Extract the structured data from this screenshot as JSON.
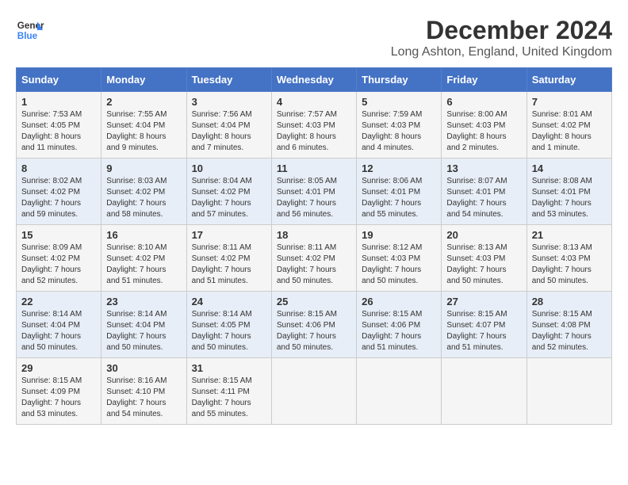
{
  "logo": {
    "line1": "General",
    "line2": "Blue"
  },
  "title": "December 2024",
  "subtitle": "Long Ashton, England, United Kingdom",
  "weekdays": [
    "Sunday",
    "Monday",
    "Tuesday",
    "Wednesday",
    "Thursday",
    "Friday",
    "Saturday"
  ],
  "weeks": [
    [
      {
        "day": "1",
        "info": "Sunrise: 7:53 AM\nSunset: 4:05 PM\nDaylight: 8 hours and 11 minutes."
      },
      {
        "day": "2",
        "info": "Sunrise: 7:55 AM\nSunset: 4:04 PM\nDaylight: 8 hours and 9 minutes."
      },
      {
        "day": "3",
        "info": "Sunrise: 7:56 AM\nSunset: 4:04 PM\nDaylight: 8 hours and 7 minutes."
      },
      {
        "day": "4",
        "info": "Sunrise: 7:57 AM\nSunset: 4:03 PM\nDaylight: 8 hours and 6 minutes."
      },
      {
        "day": "5",
        "info": "Sunrise: 7:59 AM\nSunset: 4:03 PM\nDaylight: 8 hours and 4 minutes."
      },
      {
        "day": "6",
        "info": "Sunrise: 8:00 AM\nSunset: 4:03 PM\nDaylight: 8 hours and 2 minutes."
      },
      {
        "day": "7",
        "info": "Sunrise: 8:01 AM\nSunset: 4:02 PM\nDaylight: 8 hours and 1 minute."
      }
    ],
    [
      {
        "day": "8",
        "info": "Sunrise: 8:02 AM\nSunset: 4:02 PM\nDaylight: 7 hours and 59 minutes."
      },
      {
        "day": "9",
        "info": "Sunrise: 8:03 AM\nSunset: 4:02 PM\nDaylight: 7 hours and 58 minutes."
      },
      {
        "day": "10",
        "info": "Sunrise: 8:04 AM\nSunset: 4:02 PM\nDaylight: 7 hours and 57 minutes."
      },
      {
        "day": "11",
        "info": "Sunrise: 8:05 AM\nSunset: 4:01 PM\nDaylight: 7 hours and 56 minutes."
      },
      {
        "day": "12",
        "info": "Sunrise: 8:06 AM\nSunset: 4:01 PM\nDaylight: 7 hours and 55 minutes."
      },
      {
        "day": "13",
        "info": "Sunrise: 8:07 AM\nSunset: 4:01 PM\nDaylight: 7 hours and 54 minutes."
      },
      {
        "day": "14",
        "info": "Sunrise: 8:08 AM\nSunset: 4:01 PM\nDaylight: 7 hours and 53 minutes."
      }
    ],
    [
      {
        "day": "15",
        "info": "Sunrise: 8:09 AM\nSunset: 4:02 PM\nDaylight: 7 hours and 52 minutes."
      },
      {
        "day": "16",
        "info": "Sunrise: 8:10 AM\nSunset: 4:02 PM\nDaylight: 7 hours and 51 minutes."
      },
      {
        "day": "17",
        "info": "Sunrise: 8:11 AM\nSunset: 4:02 PM\nDaylight: 7 hours and 51 minutes."
      },
      {
        "day": "18",
        "info": "Sunrise: 8:11 AM\nSunset: 4:02 PM\nDaylight: 7 hours and 50 minutes."
      },
      {
        "day": "19",
        "info": "Sunrise: 8:12 AM\nSunset: 4:03 PM\nDaylight: 7 hours and 50 minutes."
      },
      {
        "day": "20",
        "info": "Sunrise: 8:13 AM\nSunset: 4:03 PM\nDaylight: 7 hours and 50 minutes."
      },
      {
        "day": "21",
        "info": "Sunrise: 8:13 AM\nSunset: 4:03 PM\nDaylight: 7 hours and 50 minutes."
      }
    ],
    [
      {
        "day": "22",
        "info": "Sunrise: 8:14 AM\nSunset: 4:04 PM\nDaylight: 7 hours and 50 minutes."
      },
      {
        "day": "23",
        "info": "Sunrise: 8:14 AM\nSunset: 4:04 PM\nDaylight: 7 hours and 50 minutes."
      },
      {
        "day": "24",
        "info": "Sunrise: 8:14 AM\nSunset: 4:05 PM\nDaylight: 7 hours and 50 minutes."
      },
      {
        "day": "25",
        "info": "Sunrise: 8:15 AM\nSunset: 4:06 PM\nDaylight: 7 hours and 50 minutes."
      },
      {
        "day": "26",
        "info": "Sunrise: 8:15 AM\nSunset: 4:06 PM\nDaylight: 7 hours and 51 minutes."
      },
      {
        "day": "27",
        "info": "Sunrise: 8:15 AM\nSunset: 4:07 PM\nDaylight: 7 hours and 51 minutes."
      },
      {
        "day": "28",
        "info": "Sunrise: 8:15 AM\nSunset: 4:08 PM\nDaylight: 7 hours and 52 minutes."
      }
    ],
    [
      {
        "day": "29",
        "info": "Sunrise: 8:15 AM\nSunset: 4:09 PM\nDaylight: 7 hours and 53 minutes."
      },
      {
        "day": "30",
        "info": "Sunrise: 8:16 AM\nSunset: 4:10 PM\nDaylight: 7 hours and 54 minutes."
      },
      {
        "day": "31",
        "info": "Sunrise: 8:15 AM\nSunset: 4:11 PM\nDaylight: 7 hours and 55 minutes."
      },
      null,
      null,
      null,
      null
    ]
  ]
}
